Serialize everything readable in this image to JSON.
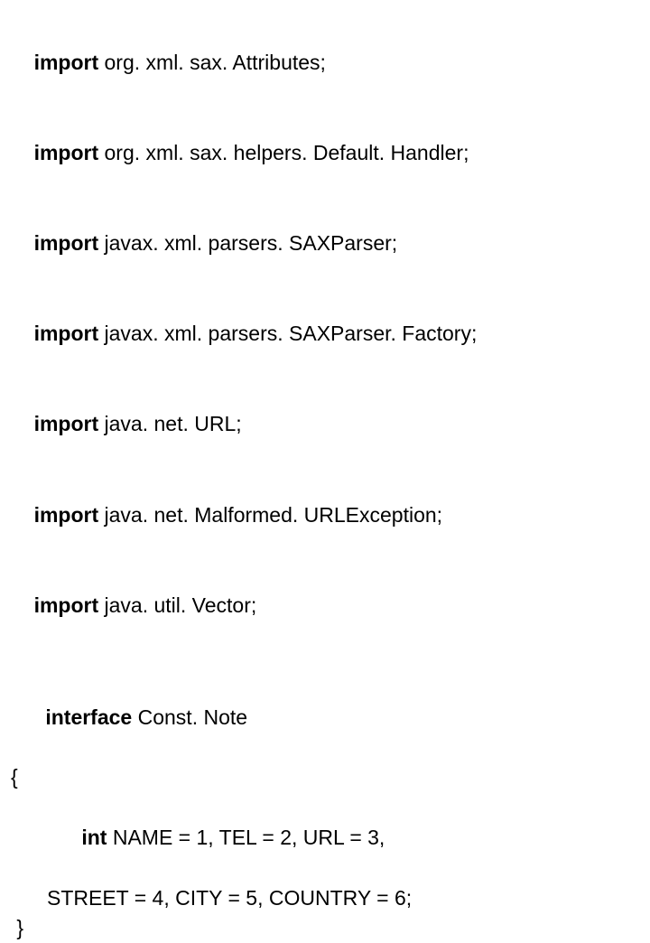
{
  "imports": {
    "kw": "import",
    "lines": [
      " org. xml. sax. Attributes;",
      " org. xml. sax. helpers. Default. Handler;",
      " javax. xml. parsers. SAXParser;",
      " javax. xml. parsers. SAXParser. Factory;",
      " java. net. URL;",
      " java. net. Malformed. URLException;",
      " java. util. Vector;"
    ]
  },
  "iface": {
    "kw": "interface",
    "name": " Const. Note",
    "open": "{",
    "body_kw": "int",
    "body1": " NAME = 1, TEL = 2, URL = 3,",
    "body2": "STREET = 4, CITY = 5, COUNTRY = 6;",
    "close": " }"
  }
}
